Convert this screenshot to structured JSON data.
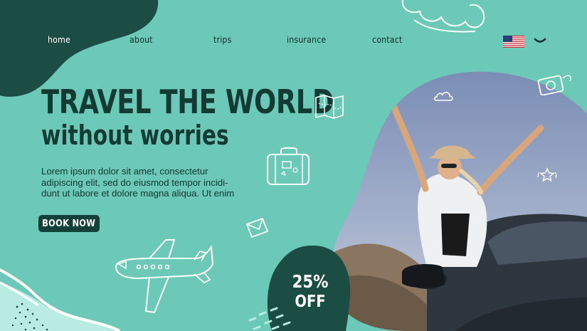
{
  "nav": {
    "items": [
      {
        "label": "home",
        "active": true
      },
      {
        "label": "about",
        "active": false
      },
      {
        "label": "trips",
        "active": false
      },
      {
        "label": "insurance",
        "active": false
      },
      {
        "label": "contact",
        "active": false
      }
    ],
    "language_icon": "us-flag-icon",
    "dropdown_icon": "chevron-down-icon"
  },
  "hero": {
    "title": "TRAVEL THE WORLD",
    "subtitle": "without worries",
    "body_lines": [
      "Lorem ipsum dolor sit amet, consectetur",
      "adipiscing elit, sed do eiusmod tempor incidi-",
      "dunt ut labore et dolore magna aliqua. Ut enim"
    ],
    "cta_label": "BOOK NOW"
  },
  "promo": {
    "line1": "25%",
    "line2": "OFF"
  },
  "colors": {
    "background": "#6cc9b7",
    "dark_teal": "#14403a",
    "text_dark": "#133b34",
    "nav_active": "#ffffff"
  },
  "decorations": [
    "cloud-icon",
    "map-icon",
    "suitcase-icon",
    "envelope-icon",
    "airplane-icon",
    "camera-icon",
    "star-icon"
  ]
}
